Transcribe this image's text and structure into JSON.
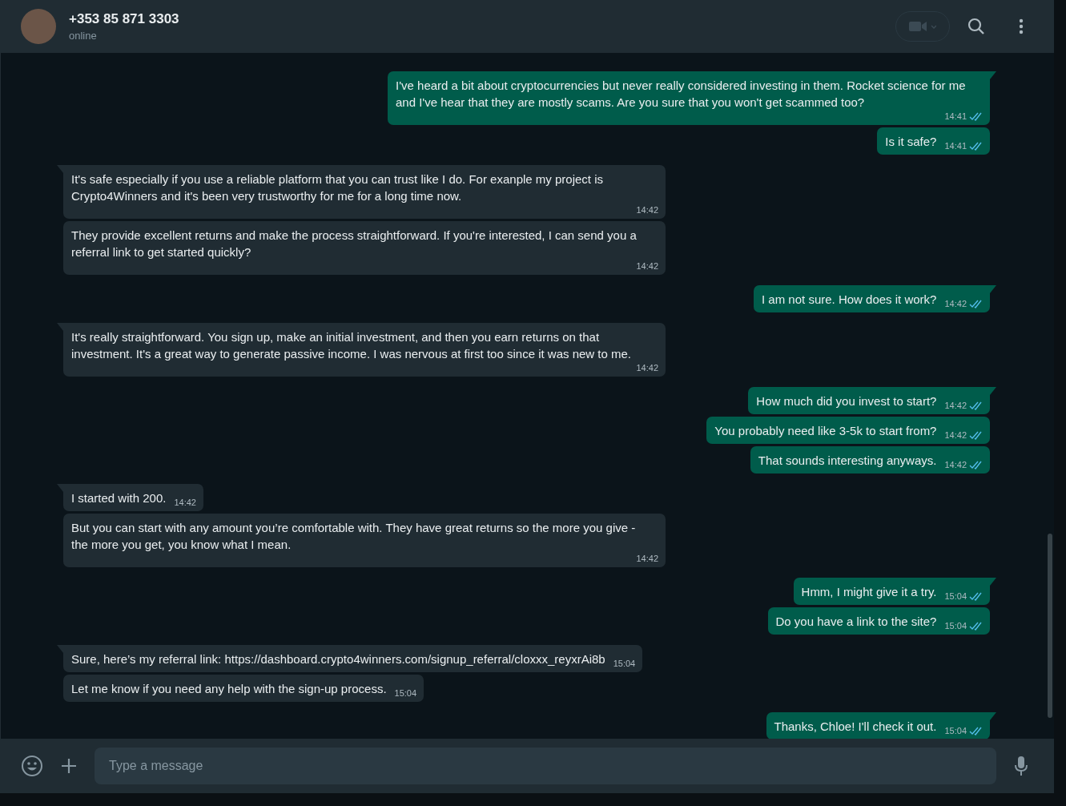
{
  "header": {
    "contact": "+353 85 871 3303",
    "status": "online"
  },
  "messages": [
    {
      "kind": "outgoing",
      "tail": true,
      "text": "I've heard a bit about cryptocurrencies but never really considered investing in them. Rocket science for me and I've hear that they are mostly scams. Are you sure that you won't get scammed too?",
      "time": "14:41",
      "read": true
    },
    {
      "kind": "outgoing",
      "tail": false,
      "text": "Is it safe?",
      "time": "14:41",
      "read": true
    },
    {
      "kind": "incoming",
      "tail": true,
      "text": "It's safe especially if you use a reliable platform that you can trust like I do. For exanple my project is Crypto4Winners and it's been very trustworthy for me for a long time now.",
      "time": "14:42"
    },
    {
      "kind": "incoming",
      "tail": false,
      "text": "They provide excellent returns and make the process straightforward. If you're interested, I can send you a referral link to get started quickly?",
      "time": "14:42"
    },
    {
      "kind": "outgoing",
      "tail": true,
      "text": "I am not sure. How does it work?",
      "time": "14:42",
      "read": true
    },
    {
      "kind": "incoming",
      "tail": true,
      "text": "It's really straightforward. You sign up, make an initial investment, and then you earn returns on that investment. It's a great way to generate passive income. I was nervous at first too since it was new to me.",
      "time": "14:42"
    },
    {
      "kind": "outgoing",
      "tail": true,
      "text": "How much did you invest to start?",
      "time": "14:42",
      "read": true
    },
    {
      "kind": "outgoing",
      "tail": false,
      "text": "You probably need like 3-5k to start from?",
      "time": "14:42",
      "read": true
    },
    {
      "kind": "outgoing",
      "tail": false,
      "text": "That sounds interesting anyways.",
      "time": "14:42",
      "read": true
    },
    {
      "kind": "incoming",
      "tail": true,
      "text": "I started with 200.",
      "time": "14:42"
    },
    {
      "kind": "incoming",
      "tail": false,
      "text": "But you can start with any amount you’re comfortable with. They have great returns so the more you give - the more you get, you know what I mean.",
      "time": "14:42"
    },
    {
      "kind": "outgoing",
      "tail": true,
      "text": "Hmm, I might give it a try.",
      "time": "15:04",
      "read": true
    },
    {
      "kind": "outgoing",
      "tail": false,
      "text": "Do you have a link to the site?",
      "time": "15:04",
      "read": true
    },
    {
      "kind": "incoming",
      "tail": true,
      "text": "Sure, here’s my referral link: https://dashboard.crypto4winners.com/signup_referral/cloxxx_reyxrAi8b",
      "time": "15:04"
    },
    {
      "kind": "incoming",
      "tail": false,
      "text": "Let me know if you need any help with the sign-up process.",
      "time": "15:04"
    },
    {
      "kind": "outgoing",
      "tail": true,
      "text": "Thanks, Chloe! I'll check it out.",
      "time": "15:04",
      "read": true
    }
  ],
  "composer": {
    "placeholder": "Type a message"
  }
}
